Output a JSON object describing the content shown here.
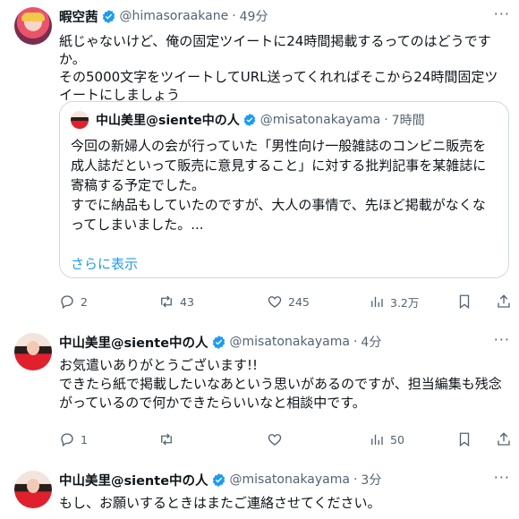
{
  "tweets": [
    {
      "name": "暇空茜",
      "handle": "@himasoraakane",
      "time": "49分",
      "text": "紙じゃないけど、俺の固定ツイートに24時間掲載するってのはどうですか。\nその5000文字をツイートしてURL送ってくれればそこから24時間固定ツイートにしましょう",
      "quote": {
        "name": "中山美里@siente中の人",
        "handle": "@misatonakayama",
        "time": "7時間",
        "text": "今回の新婦人の会が行っていた「男性向け一般雑誌のコンビニ販売を成人誌だといって販売に意見すること」に対する批判記事を某雑誌に寄稿する予定でした。\nすでに納品もしていたのですが、大人の事情で、先ほど掲載がなくなってしまいました。...",
        "show_more": "さらに表示"
      },
      "stats": {
        "replies": "2",
        "retweets": "43",
        "likes": "245",
        "views": "3.2万"
      }
    },
    {
      "name": "中山美里@siente中の人",
      "handle": "@misatonakayama",
      "time": "4分",
      "text": "お気遣いありがとうございます!!\nできたら紙で掲載したいなあという思いがあるのですが、担当編集も残念がっているので何かできたらいいなと相談中です。",
      "stats": {
        "replies": "1",
        "retweets": "",
        "likes": "",
        "views": "50"
      }
    },
    {
      "name": "中山美里@siente中の人",
      "handle": "@misatonakayama",
      "time": "3分",
      "text": "もし、お願いするときはまたご連絡させてください。"
    }
  ],
  "ui": {
    "dot": "·",
    "more": "···"
  },
  "colors": {
    "verified": "#1d9bf0",
    "link": "#1d9bf0",
    "muted": "#536471"
  }
}
